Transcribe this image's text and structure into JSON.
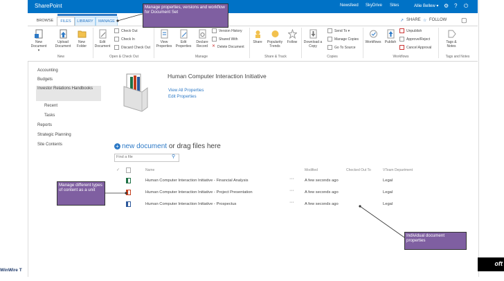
{
  "suite": {
    "title": "SharePoint",
    "links": [
      "Newsfeed",
      "SkyDrive",
      "Sites"
    ],
    "user": "Allie Bellew ▾",
    "icons": [
      "gear-icon",
      "help-icon",
      "power-icon"
    ]
  },
  "tabs": [
    "BROWSE",
    "FILES",
    "LIBRARY",
    "MANAGE"
  ],
  "share_label": "SHARE",
  "follow_label": "FOLLOW",
  "ribbon": {
    "new_group": {
      "label": "New",
      "buttons": [
        "New Document ▾",
        "Upload Document",
        "New Folder"
      ]
    },
    "open_group": {
      "label": "Open & Check Out",
      "button": "Edit Document",
      "small": [
        "Check Out",
        "Check In",
        "Discard Check Out"
      ]
    },
    "manage_group": {
      "label": "Manage",
      "buttons": [
        "View Properties",
        "Edit Properties",
        "Declare Record"
      ],
      "small": [
        "Version History",
        "Shared With",
        "Delete Document"
      ]
    },
    "share_group": {
      "label": "Share & Track",
      "buttons": [
        "Share",
        "Popularity Trends",
        "Follow"
      ]
    },
    "copies_group": {
      "label": "Copies",
      "button": "Download a Copy",
      "small": [
        "Send To ▾",
        "Manage Copies",
        "Go To Source"
      ]
    },
    "workflows_group": {
      "label": "Workflows",
      "buttons": [
        "Workflows",
        "Publish"
      ],
      "small": [
        "Unpublish",
        "Approve/Reject",
        "Cancel Approval"
      ]
    },
    "tags_group": {
      "label": "Tags and Notes",
      "button": "Tags & Notes"
    }
  },
  "nav": [
    "Accounting",
    "Budgets",
    "Investor Relations Handbooks",
    "Recent",
    "Tasks",
    "Reports",
    "Strategic Planning",
    "Site Contents"
  ],
  "docset": {
    "title": "Human Computer Interaction Initiative",
    "links": [
      "View All Properties",
      "Edit Properties"
    ]
  },
  "new_document": {
    "link": "new document",
    "rest": " or drag files here"
  },
  "search": {
    "placeholder": "Find a file"
  },
  "columns": [
    "Name",
    "Modified",
    "Checked Out To",
    "VTeam Department"
  ],
  "rows": [
    {
      "name": "Human Computer Interaction Initiative - Financial Analysis",
      "modified": "A few seconds ago",
      "dept": "Legal",
      "icon": "excel-doc-icon"
    },
    {
      "name": "Human Computer Interaction Initiative - Project Presentation",
      "modified": "A few seconds ago",
      "dept": "Legal",
      "icon": "powerpoint-doc-icon"
    },
    {
      "name": "Human Computer Interaction Initiative - Prospectus",
      "modified": "A few seconds ago",
      "dept": "Legal",
      "icon": "word-doc-icon"
    }
  ],
  "callouts": {
    "manage": "Manage properties, versions and workflow for Document Set",
    "content": "Manage different types of content as a unit",
    "properties": "Individual document properties"
  },
  "footer": {
    "left": "WinWire T",
    "logo": "oft"
  },
  "colors": {
    "suite_bar": "#0072c6",
    "callout": "#7f5fa1",
    "link": "#2c79c6"
  }
}
